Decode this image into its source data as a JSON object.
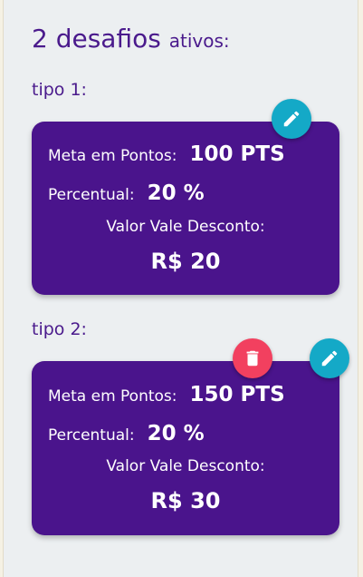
{
  "header": {
    "count": "2 desafios",
    "suffix": "ativos:"
  },
  "challenges": [
    {
      "type_label": "tipo 1:",
      "meta_label": "Meta em Pontos:",
      "meta_value": "100 PTS",
      "percent_label": "Percentual:",
      "percent_value": "20 %",
      "voucher_label": "Valor Vale Desconto:",
      "voucher_value": "R$ 20"
    },
    {
      "type_label": "tipo 2:",
      "meta_label": "Meta em Pontos:",
      "meta_value": "150 PTS",
      "percent_label": "Percentual:",
      "percent_value": "20 %",
      "voucher_label": "Valor Vale Desconto:",
      "voucher_value": "R$ 30"
    }
  ],
  "icons": {
    "edit": "pencil-icon",
    "delete": "trash-icon"
  },
  "colors": {
    "primary": "#4a148c",
    "edit_button": "#14a9c7",
    "delete_button": "#f2405f",
    "text_title": "#4a1a8c"
  }
}
